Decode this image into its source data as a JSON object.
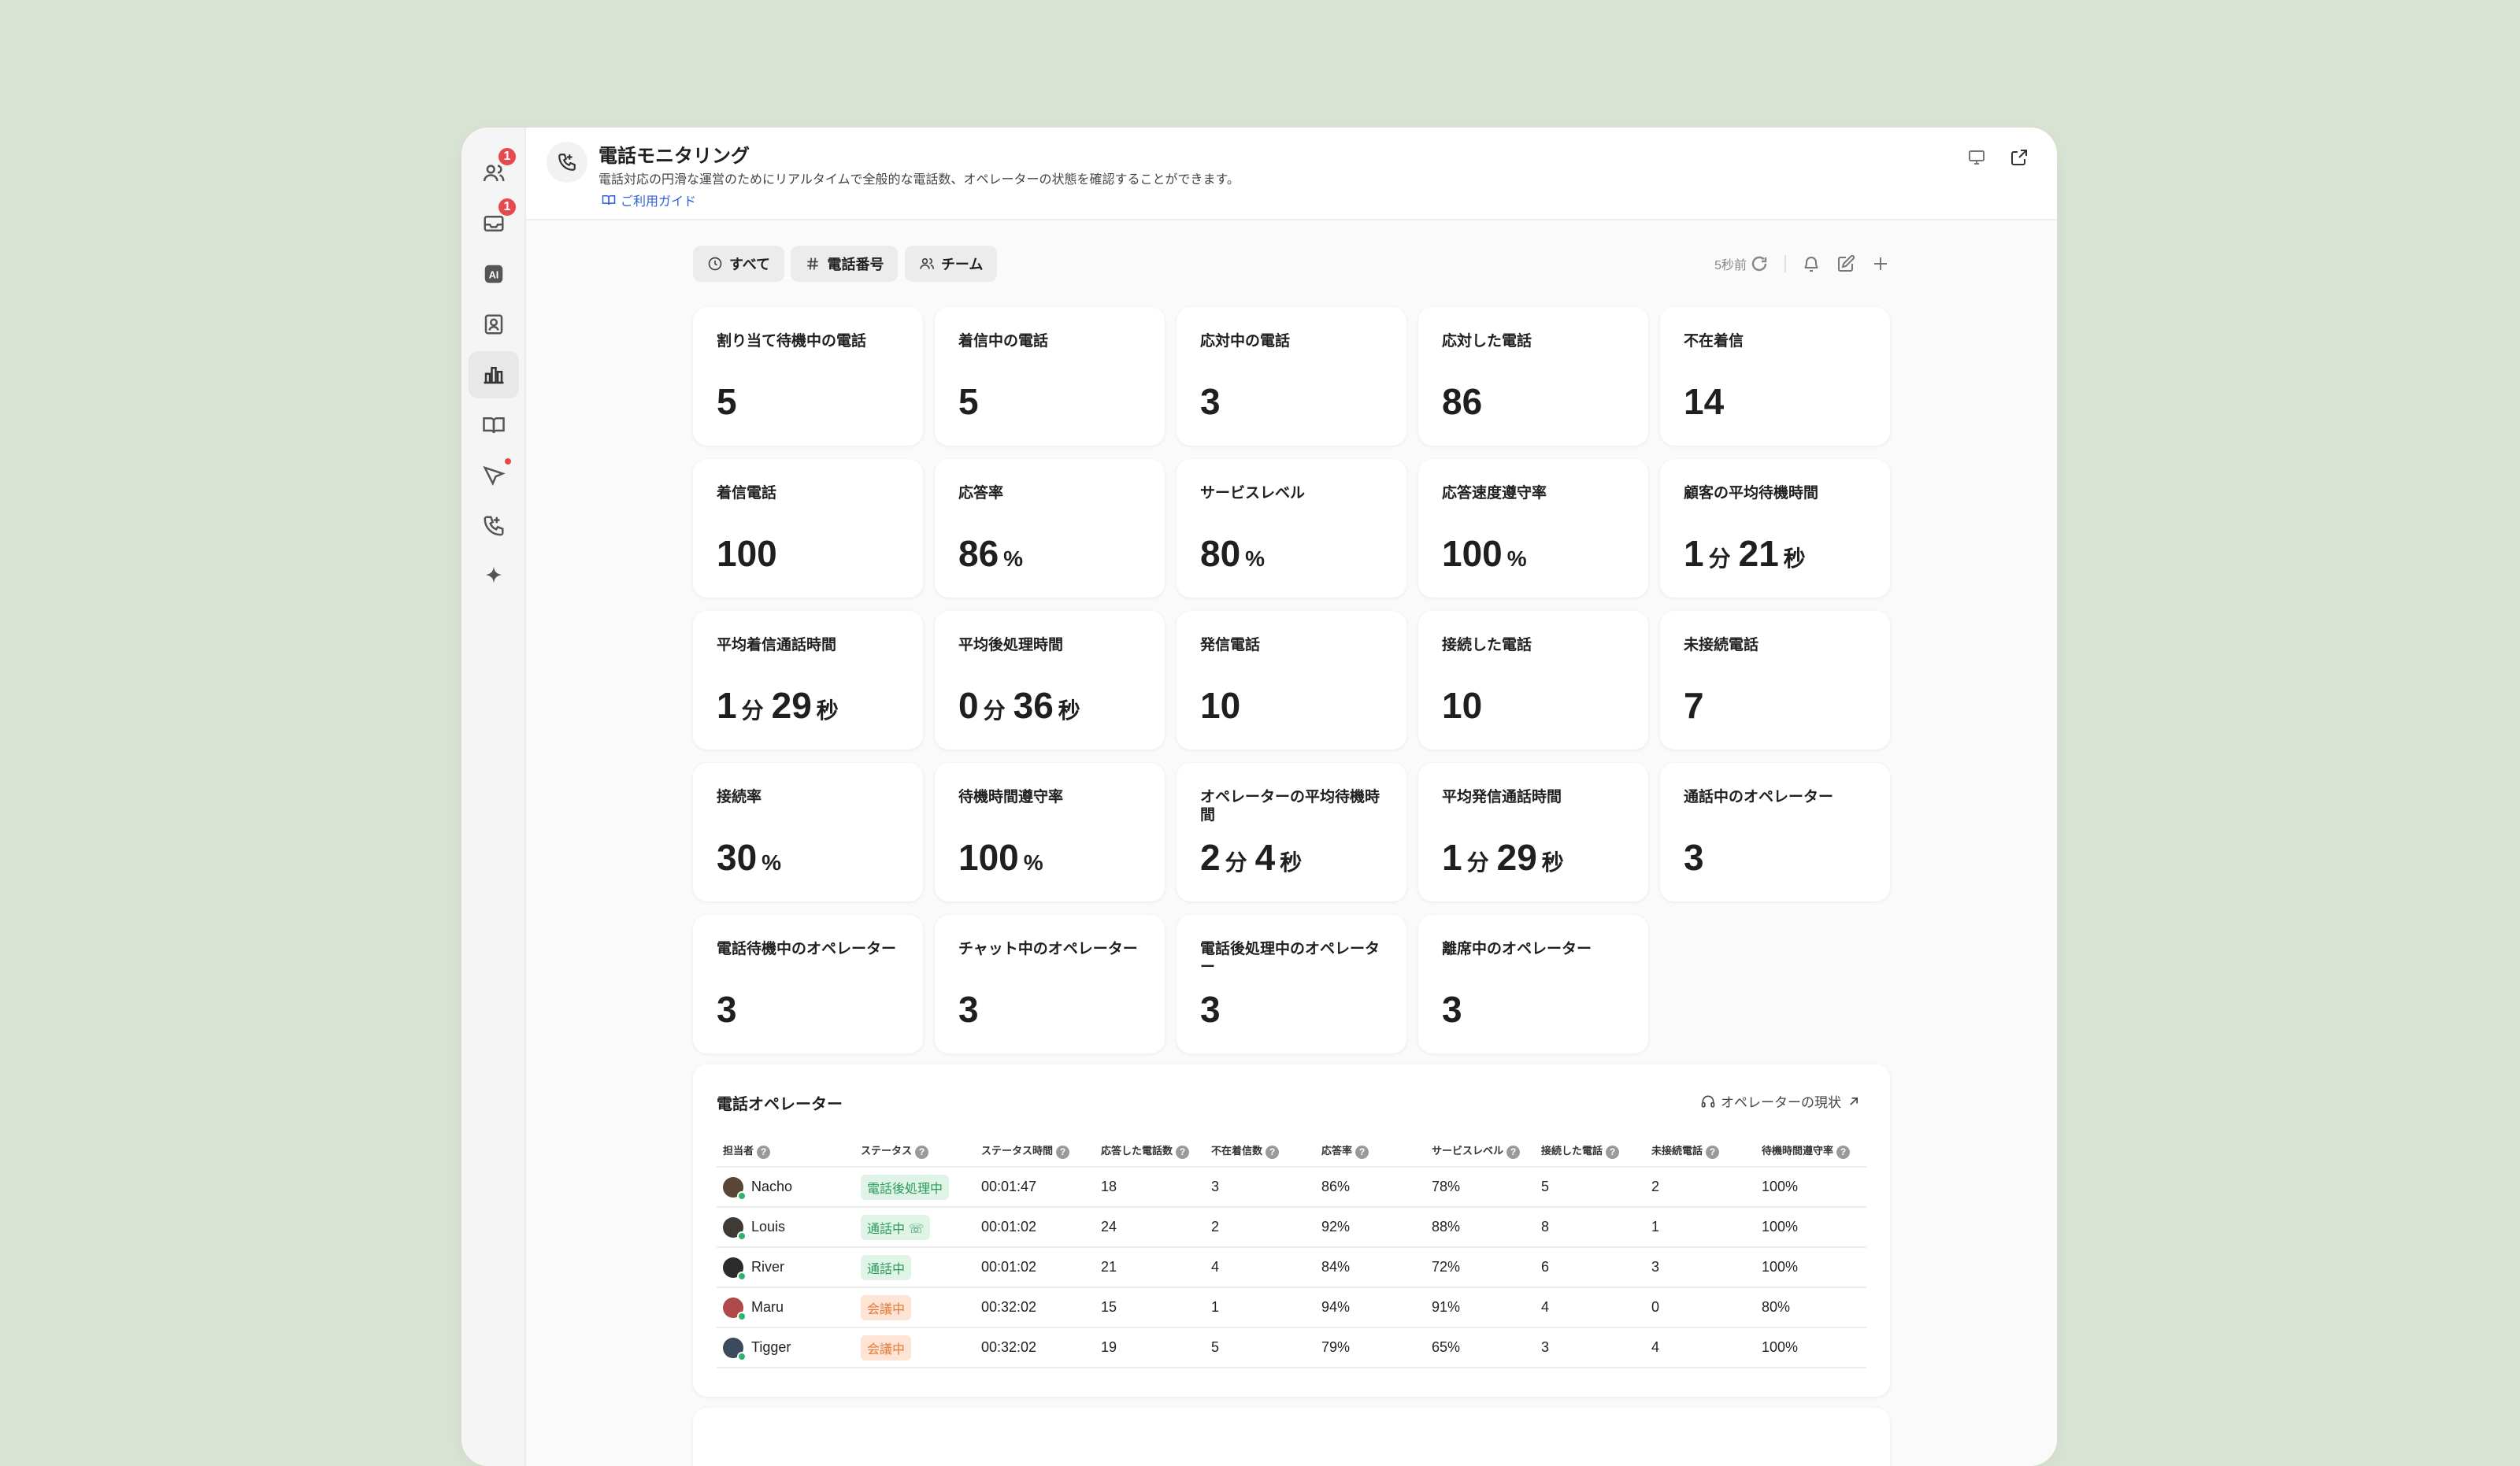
{
  "rail": {
    "icons": [
      {
        "name": "users-icon",
        "badge": "1"
      },
      {
        "name": "inbox-icon",
        "badge": "1"
      },
      {
        "name": "ai-icon",
        "label": "AI"
      },
      {
        "name": "contact-icon"
      },
      {
        "name": "chart-icon"
      },
      {
        "name": "book-icon"
      },
      {
        "name": "campaign-icon"
      },
      {
        "name": "phone-icon"
      },
      {
        "name": "sparkle-icon"
      }
    ]
  },
  "header": {
    "title": "電話モニタリング",
    "subtitle": "電話対応の円滑な運営のためにリアルタイムで全般的な電話数、オペレーターの状態を確認することができます。",
    "guide_link": "ご利用ガイド"
  },
  "toolbar": {
    "filters": [
      "すべて",
      "電話番号",
      "チーム"
    ],
    "updated": "5秒前"
  },
  "metrics": [
    {
      "label": "割り当て待機中の電話",
      "parts": [
        {
          "v": "5"
        }
      ]
    },
    {
      "label": "着信中の電話",
      "parts": [
        {
          "v": "5"
        }
      ]
    },
    {
      "label": "応対中の電話",
      "parts": [
        {
          "v": "3"
        }
      ]
    },
    {
      "label": "応対した電話",
      "parts": [
        {
          "v": "86"
        }
      ]
    },
    {
      "label": "不在着信",
      "parts": [
        {
          "v": "14"
        }
      ]
    },
    {
      "label": "着信電話",
      "parts": [
        {
          "v": "100"
        }
      ]
    },
    {
      "label": "応答率",
      "parts": [
        {
          "v": "86",
          "u": "%"
        }
      ]
    },
    {
      "label": "サービスレベル",
      "parts": [
        {
          "v": "80",
          "u": "%"
        }
      ]
    },
    {
      "label": "応答速度遵守率",
      "parts": [
        {
          "v": "100",
          "u": "%"
        }
      ]
    },
    {
      "label": "顧客の平均待機時間",
      "parts": [
        {
          "v": "1",
          "u": "分"
        },
        {
          "v": "21",
          "u": "秒"
        }
      ]
    },
    {
      "label": "平均着信通話時間",
      "parts": [
        {
          "v": "1",
          "u": "分"
        },
        {
          "v": "29",
          "u": "秒"
        }
      ]
    },
    {
      "label": "平均後処理時間",
      "parts": [
        {
          "v": "0",
          "u": "分"
        },
        {
          "v": "36",
          "u": "秒"
        }
      ]
    },
    {
      "label": "発信電話",
      "parts": [
        {
          "v": "10"
        }
      ]
    },
    {
      "label": "接続した電話",
      "parts": [
        {
          "v": "10"
        }
      ]
    },
    {
      "label": "未接続電話",
      "parts": [
        {
          "v": "7"
        }
      ]
    },
    {
      "label": "接続率",
      "parts": [
        {
          "v": "30",
          "u": "%"
        }
      ]
    },
    {
      "label": "待機時間遵守率",
      "parts": [
        {
          "v": "100",
          "u": "%"
        }
      ]
    },
    {
      "label": "オペレーターの平均待機時間",
      "parts": [
        {
          "v": "2",
          "u": "分"
        },
        {
          "v": "4",
          "u": "秒"
        }
      ]
    },
    {
      "label": "平均発信通話時間",
      "parts": [
        {
          "v": "1",
          "u": "分"
        },
        {
          "v": "29",
          "u": "秒"
        }
      ]
    },
    {
      "label": "通話中のオペレーター",
      "parts": [
        {
          "v": "3"
        }
      ]
    },
    {
      "label": "電話待機中のオペレーター",
      "parts": [
        {
          "v": "3"
        }
      ]
    },
    {
      "label": "チャット中のオペレーター",
      "parts": [
        {
          "v": "3"
        }
      ]
    },
    {
      "label": "電話後処理中のオペレーター",
      "parts": [
        {
          "v": "3"
        }
      ]
    },
    {
      "label": "離席中のオペレーター",
      "parts": [
        {
          "v": "3"
        }
      ]
    }
  ],
  "operators": {
    "title": "電話オペレーター",
    "link": "オペレーターの現状",
    "columns": [
      "担当者",
      "ステータス",
      "ステータス時間",
      "応答した電話数",
      "不在着信数",
      "応答率",
      "サービスレベル",
      "接続した電話",
      "未接続電話",
      "待機時間遵守率"
    ],
    "rows": [
      {
        "name": "Nacho",
        "status": "電話後処理中",
        "status_color": "green",
        "time": "00:01:47",
        "answered": "18",
        "missed": "3",
        "rate": "86%",
        "service": "78%",
        "connected": "5",
        "unconnected": "2",
        "wait": "100%",
        "avatar_color": "#5a4634"
      },
      {
        "name": "Louis",
        "status": "通話中 ☏",
        "status_color": "green",
        "time": "00:01:02",
        "answered": "24",
        "missed": "2",
        "rate": "92%",
        "service": "88%",
        "connected": "8",
        "unconnected": "1",
        "wait": "100%",
        "avatar_color": "#3f3a35"
      },
      {
        "name": "River",
        "status": "通話中",
        "status_color": "green",
        "time": "00:01:02",
        "answered": "21",
        "missed": "4",
        "rate": "84%",
        "service": "72%",
        "connected": "6",
        "unconnected": "3",
        "wait": "100%",
        "avatar_color": "#2c2c2c"
      },
      {
        "name": "Maru",
        "status": "会議中",
        "status_color": "orange",
        "time": "00:32:02",
        "answered": "15",
        "missed": "1",
        "rate": "94%",
        "service": "91%",
        "connected": "4",
        "unconnected": "0",
        "wait": "80%",
        "avatar_color": "#b0494a"
      },
      {
        "name": "Tigger",
        "status": "会議中",
        "status_color": "orange",
        "time": "00:32:02",
        "answered": "19",
        "missed": "5",
        "rate": "79%",
        "service": "65%",
        "connected": "3",
        "unconnected": "4",
        "wait": "100%",
        "avatar_color": "#3c4a5e"
      }
    ]
  },
  "colors": {
    "background": "#d9e4d5",
    "badge_red": "#e5484d",
    "status_green": "#2a9a5a",
    "status_orange": "#e4783a",
    "link_blue": "#2f5fd6"
  }
}
